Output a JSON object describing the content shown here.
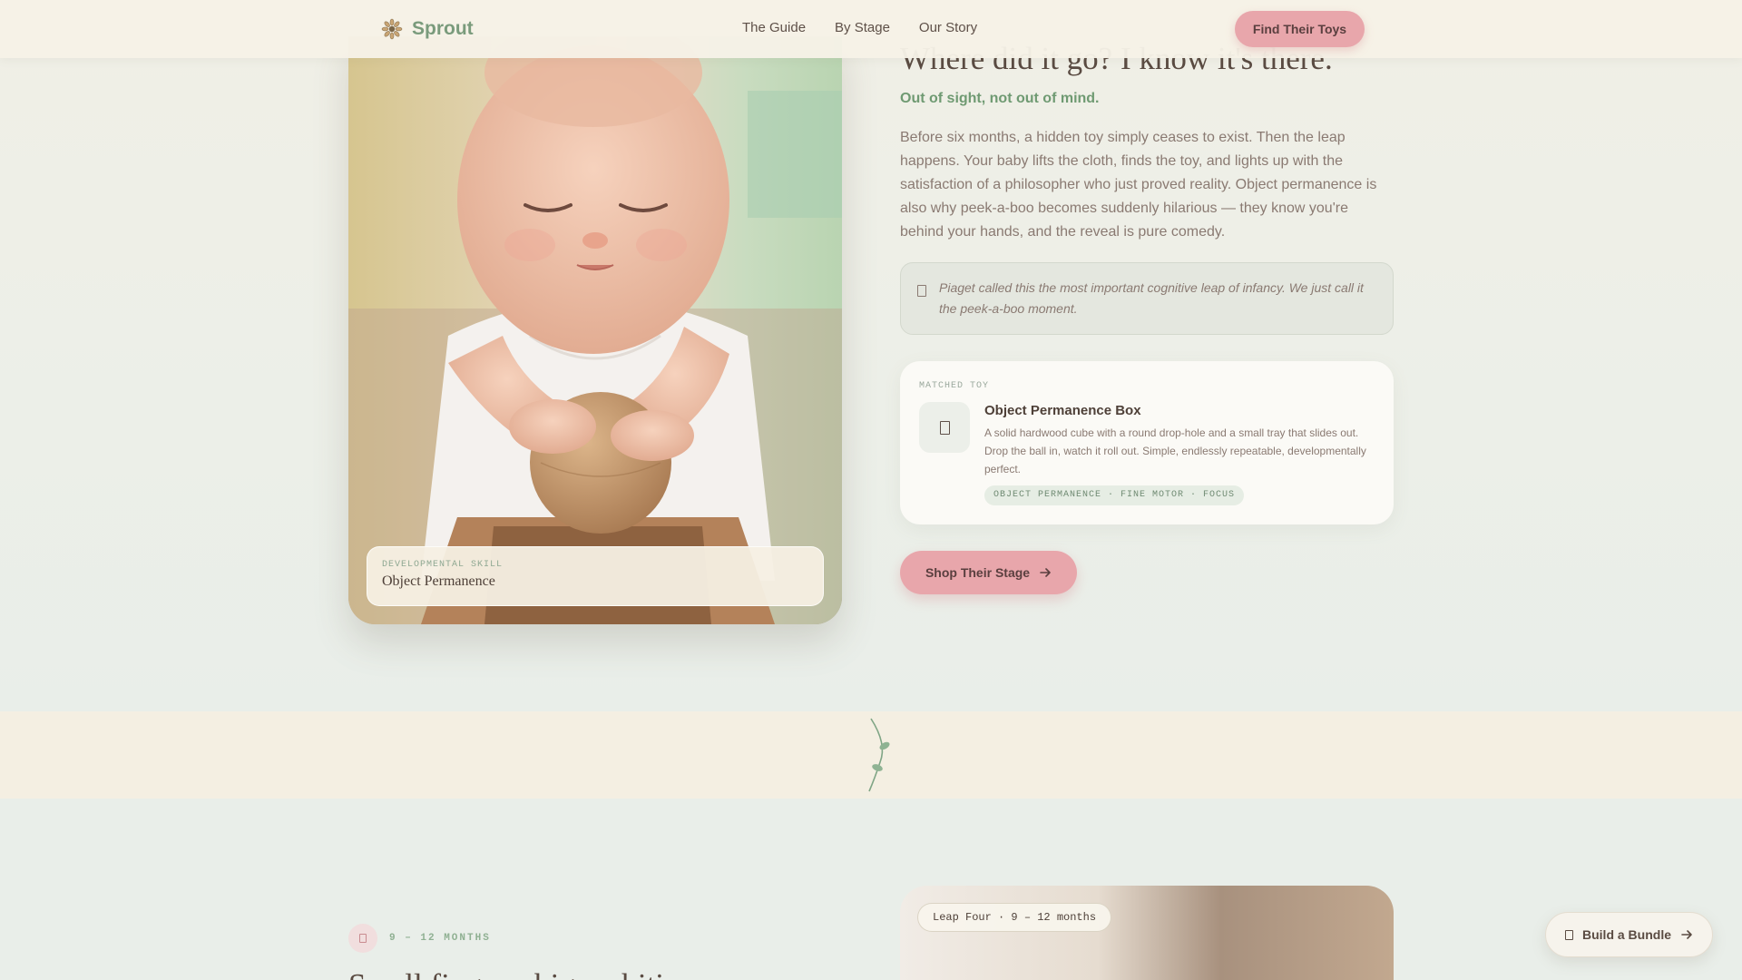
{
  "nav": {
    "brand": "Sprout",
    "links": [
      "The Guide",
      "By Stage",
      "Our Story"
    ],
    "cta": "Find Their Toys"
  },
  "hero": {
    "skill_kicker": "DEVELOPMENTAL SKILL",
    "skill_name": "Object Permanence",
    "title": "Where did it go? I know it's there.",
    "subtitle": "Out of sight, not out of mind.",
    "body": "Before six months, a hidden toy simply ceases to exist. Then the leap happens. Your baby lifts the cloth, finds the toy, and lights up with the satisfaction of a philosopher who just proved reality. Object permanence is also why peek-a-boo becomes suddenly hilarious — they know you're behind your hands, and the reveal is pure comedy.",
    "quote": "Piaget called this the most important cognitive leap of infancy. We just call it the peek-a-boo moment."
  },
  "toy": {
    "kicker": "MATCHED TOY",
    "name": "Object Permanence Box",
    "description": "A solid hardwood cube with a round drop-hole and a small tray that slides out. Drop the ball in, watch it roll out. Simple, endlessly repeatable, developmentally perfect.",
    "tags": "OBJECT PERMANENCE · FINE MOTOR · FOCUS"
  },
  "shop_button": "Shop Their Stage",
  "next_section": {
    "stage": "9 – 12 MONTHS",
    "title": "Small fingers, big ambitions",
    "leap_pill": "Leap Four · 9 – 12 months"
  },
  "bundle_button": "Build a Bundle",
  "colors": {
    "accent_pink": "#e8a6ab",
    "brand_green": "#7a9b7c",
    "text_brown": "#5e5048"
  },
  "icons": [
    "sprout-logo-icon",
    "quote-icon",
    "toy-box-icon",
    "arrow-right-icon",
    "stage-icon",
    "bundle-icon"
  ]
}
